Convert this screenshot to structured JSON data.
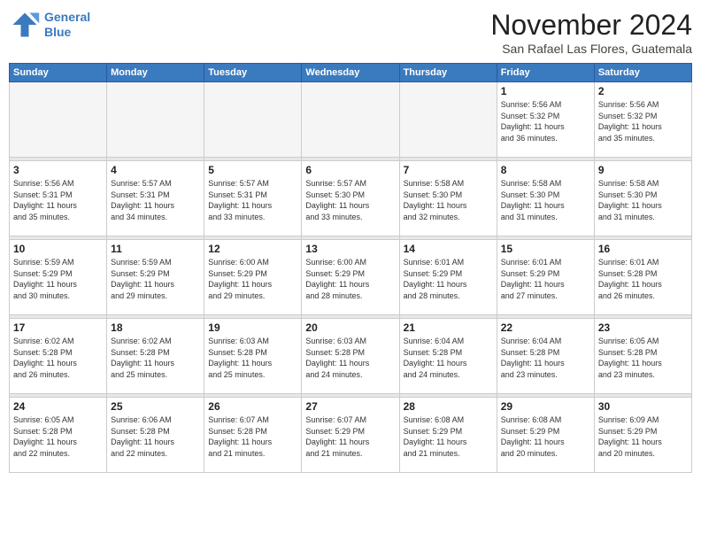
{
  "logo": {
    "line1": "General",
    "line2": "Blue"
  },
  "title": "November 2024",
  "location": "San Rafael Las Flores, Guatemala",
  "weekdays": [
    "Sunday",
    "Monday",
    "Tuesday",
    "Wednesday",
    "Thursday",
    "Friday",
    "Saturday"
  ],
  "weeks": [
    [
      {
        "day": "",
        "info": ""
      },
      {
        "day": "",
        "info": ""
      },
      {
        "day": "",
        "info": ""
      },
      {
        "day": "",
        "info": ""
      },
      {
        "day": "",
        "info": ""
      },
      {
        "day": "1",
        "info": "Sunrise: 5:56 AM\nSunset: 5:32 PM\nDaylight: 11 hours\nand 36 minutes."
      },
      {
        "day": "2",
        "info": "Sunrise: 5:56 AM\nSunset: 5:32 PM\nDaylight: 11 hours\nand 35 minutes."
      }
    ],
    [
      {
        "day": "3",
        "info": "Sunrise: 5:56 AM\nSunset: 5:31 PM\nDaylight: 11 hours\nand 35 minutes."
      },
      {
        "day": "4",
        "info": "Sunrise: 5:57 AM\nSunset: 5:31 PM\nDaylight: 11 hours\nand 34 minutes."
      },
      {
        "day": "5",
        "info": "Sunrise: 5:57 AM\nSunset: 5:31 PM\nDaylight: 11 hours\nand 33 minutes."
      },
      {
        "day": "6",
        "info": "Sunrise: 5:57 AM\nSunset: 5:30 PM\nDaylight: 11 hours\nand 33 minutes."
      },
      {
        "day": "7",
        "info": "Sunrise: 5:58 AM\nSunset: 5:30 PM\nDaylight: 11 hours\nand 32 minutes."
      },
      {
        "day": "8",
        "info": "Sunrise: 5:58 AM\nSunset: 5:30 PM\nDaylight: 11 hours\nand 31 minutes."
      },
      {
        "day": "9",
        "info": "Sunrise: 5:58 AM\nSunset: 5:30 PM\nDaylight: 11 hours\nand 31 minutes."
      }
    ],
    [
      {
        "day": "10",
        "info": "Sunrise: 5:59 AM\nSunset: 5:29 PM\nDaylight: 11 hours\nand 30 minutes."
      },
      {
        "day": "11",
        "info": "Sunrise: 5:59 AM\nSunset: 5:29 PM\nDaylight: 11 hours\nand 29 minutes."
      },
      {
        "day": "12",
        "info": "Sunrise: 6:00 AM\nSunset: 5:29 PM\nDaylight: 11 hours\nand 29 minutes."
      },
      {
        "day": "13",
        "info": "Sunrise: 6:00 AM\nSunset: 5:29 PM\nDaylight: 11 hours\nand 28 minutes."
      },
      {
        "day": "14",
        "info": "Sunrise: 6:01 AM\nSunset: 5:29 PM\nDaylight: 11 hours\nand 28 minutes."
      },
      {
        "day": "15",
        "info": "Sunrise: 6:01 AM\nSunset: 5:29 PM\nDaylight: 11 hours\nand 27 minutes."
      },
      {
        "day": "16",
        "info": "Sunrise: 6:01 AM\nSunset: 5:28 PM\nDaylight: 11 hours\nand 26 minutes."
      }
    ],
    [
      {
        "day": "17",
        "info": "Sunrise: 6:02 AM\nSunset: 5:28 PM\nDaylight: 11 hours\nand 26 minutes."
      },
      {
        "day": "18",
        "info": "Sunrise: 6:02 AM\nSunset: 5:28 PM\nDaylight: 11 hours\nand 25 minutes."
      },
      {
        "day": "19",
        "info": "Sunrise: 6:03 AM\nSunset: 5:28 PM\nDaylight: 11 hours\nand 25 minutes."
      },
      {
        "day": "20",
        "info": "Sunrise: 6:03 AM\nSunset: 5:28 PM\nDaylight: 11 hours\nand 24 minutes."
      },
      {
        "day": "21",
        "info": "Sunrise: 6:04 AM\nSunset: 5:28 PM\nDaylight: 11 hours\nand 24 minutes."
      },
      {
        "day": "22",
        "info": "Sunrise: 6:04 AM\nSunset: 5:28 PM\nDaylight: 11 hours\nand 23 minutes."
      },
      {
        "day": "23",
        "info": "Sunrise: 6:05 AM\nSunset: 5:28 PM\nDaylight: 11 hours\nand 23 minutes."
      }
    ],
    [
      {
        "day": "24",
        "info": "Sunrise: 6:05 AM\nSunset: 5:28 PM\nDaylight: 11 hours\nand 22 minutes."
      },
      {
        "day": "25",
        "info": "Sunrise: 6:06 AM\nSunset: 5:28 PM\nDaylight: 11 hours\nand 22 minutes."
      },
      {
        "day": "26",
        "info": "Sunrise: 6:07 AM\nSunset: 5:28 PM\nDaylight: 11 hours\nand 21 minutes."
      },
      {
        "day": "27",
        "info": "Sunrise: 6:07 AM\nSunset: 5:29 PM\nDaylight: 11 hours\nand 21 minutes."
      },
      {
        "day": "28",
        "info": "Sunrise: 6:08 AM\nSunset: 5:29 PM\nDaylight: 11 hours\nand 21 minutes."
      },
      {
        "day": "29",
        "info": "Sunrise: 6:08 AM\nSunset: 5:29 PM\nDaylight: 11 hours\nand 20 minutes."
      },
      {
        "day": "30",
        "info": "Sunrise: 6:09 AM\nSunset: 5:29 PM\nDaylight: 11 hours\nand 20 minutes."
      }
    ]
  ]
}
